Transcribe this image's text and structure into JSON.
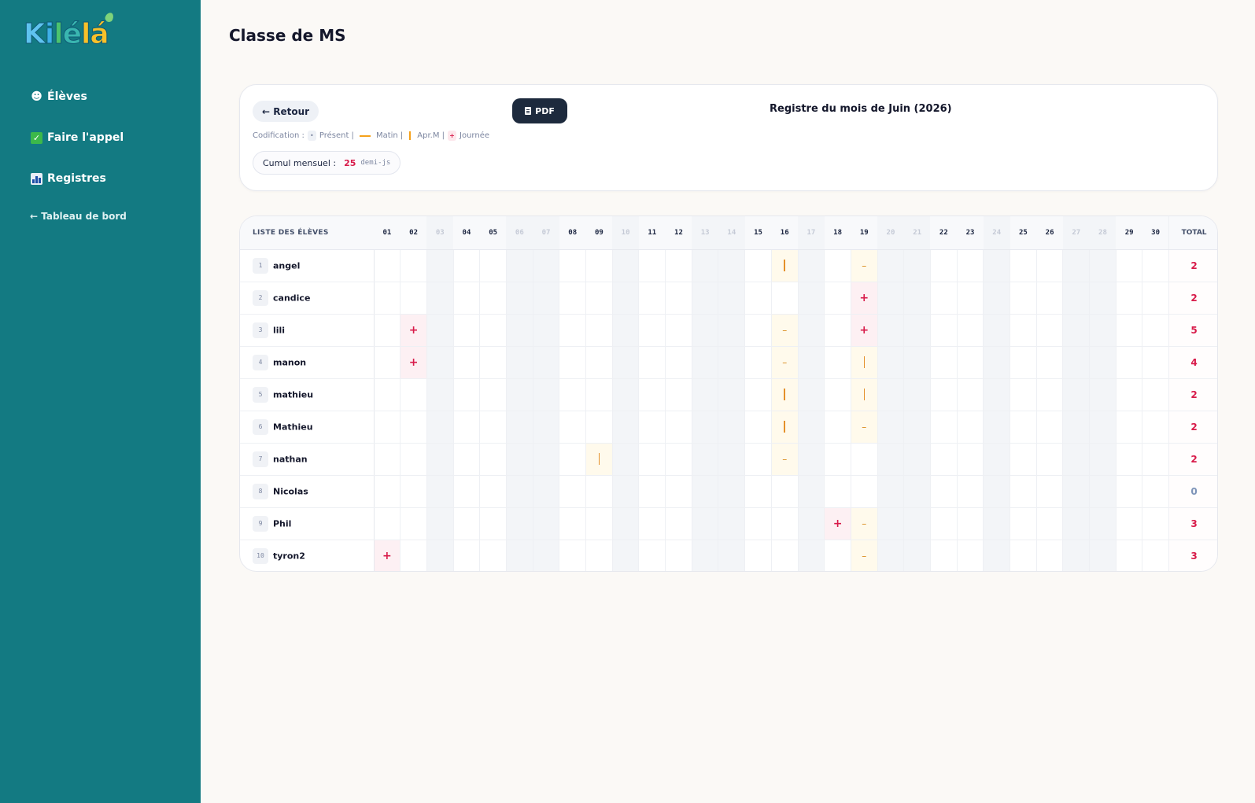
{
  "sidebar": {
    "logo_text": [
      "K",
      "i",
      "l",
      "é",
      "l",
      "á"
    ],
    "items": [
      {
        "label": "Élèves",
        "icon": "student-icon"
      },
      {
        "label": "Faire l'appel",
        "icon": "check-icon"
      },
      {
        "label": "Registres",
        "icon": "bar-chart-icon"
      }
    ],
    "back_label": "← Tableau de bord"
  },
  "page": {
    "title": "Classe de MS"
  },
  "register": {
    "back_label": "← Retour",
    "pdf_label": "PDF",
    "title": "Registre du mois de Juin (2026)",
    "legend": {
      "prefix": "Codification :",
      "present_symbol": "•",
      "present": "Présent |",
      "matin": "Matin |",
      "aprem": "Apr.M |",
      "journee_symbol": "+",
      "journee": "Journée"
    },
    "cumul": {
      "label": "Cumul mensuel :",
      "value": "25",
      "unit": "demi-js"
    }
  },
  "table": {
    "name_header": "LISTE DES ÉLÈVES",
    "total_header": "TOTAL",
    "days": [
      "01",
      "02",
      "03",
      "04",
      "05",
      "06",
      "07",
      "08",
      "09",
      "10",
      "11",
      "12",
      "13",
      "14",
      "15",
      "16",
      "17",
      "18",
      "19",
      "20",
      "21",
      "22",
      "23",
      "24",
      "25",
      "26",
      "27",
      "28",
      "29",
      "30"
    ],
    "weekend_days": [
      "03",
      "06",
      "07",
      "10",
      "13",
      "14",
      "17",
      "20",
      "21",
      "24",
      "27",
      "28"
    ],
    "symbols": {
      "journee": "+",
      "matin": "–",
      "aprem": "|"
    },
    "students": [
      {
        "num": "1",
        "name": "angel",
        "total": "2",
        "marks": {
          "16": "aprem",
          "19": "matin"
        }
      },
      {
        "num": "2",
        "name": "candice",
        "total": "2",
        "marks": {
          "19": "journee"
        }
      },
      {
        "num": "3",
        "name": "lili",
        "total": "5",
        "marks": {
          "02": "journee",
          "16": "matin",
          "19": "journee"
        }
      },
      {
        "num": "4",
        "name": "manon",
        "total": "4",
        "marks": {
          "02": "journee",
          "16": "matin",
          "19": "aprem"
        }
      },
      {
        "num": "5",
        "name": "mathieu",
        "total": "2",
        "marks": {
          "16": "aprem",
          "19": "aprem"
        }
      },
      {
        "num": "6",
        "name": "Mathieu",
        "total": "2",
        "marks": {
          "16": "aprem",
          "19": "matin"
        }
      },
      {
        "num": "7",
        "name": "nathan",
        "total": "2",
        "marks": {
          "09": "aprem",
          "16": "matin"
        }
      },
      {
        "num": "8",
        "name": "Nicolas",
        "total": "0",
        "marks": {}
      },
      {
        "num": "9",
        "name": "Phil",
        "total": "3",
        "marks": {
          "18": "journee",
          "19": "matin"
        }
      },
      {
        "num": "10",
        "name": "tyron2",
        "total": "3",
        "marks": {
          "01": "journee",
          "19": "matin"
        }
      }
    ]
  },
  "colors": {
    "sidebar_bg": "#137a82",
    "journee": "#d81b4a",
    "half_day": "#e4902a",
    "pdf_button": "#1d2a3d"
  }
}
